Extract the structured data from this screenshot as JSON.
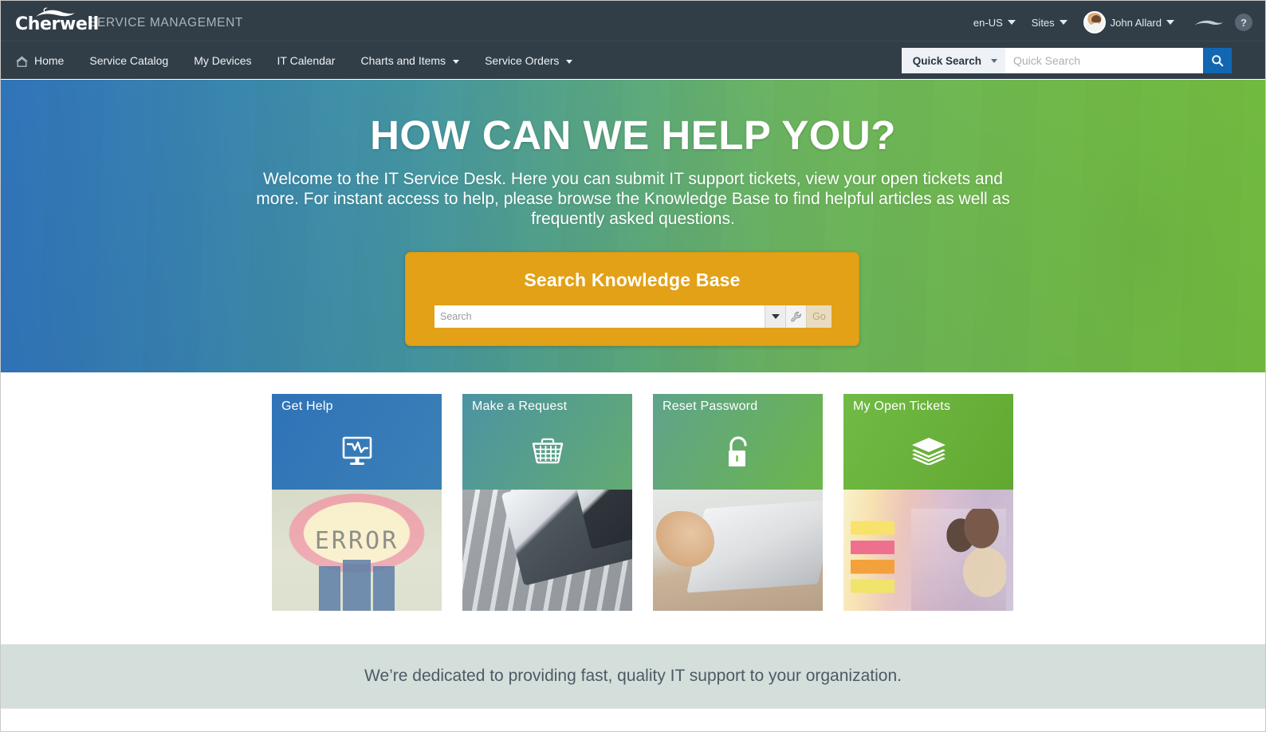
{
  "header": {
    "brand_word": "Cherwell",
    "brand_subtitle": "SERVICE MANAGEMENT",
    "locale": "en-US",
    "sites": "Sites",
    "user_name": "John Allard",
    "help_glyph": "?",
    "icons": {
      "avatar": "avatar",
      "swoosh": "cherwell-swoosh-icon",
      "help": "help-icon"
    }
  },
  "nav": {
    "items": [
      {
        "label": "Home",
        "has_caret": false,
        "icon": "home-icon"
      },
      {
        "label": "Service Catalog",
        "has_caret": false
      },
      {
        "label": "My Devices",
        "has_caret": false
      },
      {
        "label": "IT Calendar",
        "has_caret": false
      },
      {
        "label": "Charts and Items",
        "has_caret": true
      },
      {
        "label": "Service Orders",
        "has_caret": true
      }
    ]
  },
  "quick_search": {
    "scope_label": "Quick Search",
    "placeholder": "Quick Search",
    "value": "",
    "button_icon": "search-icon",
    "button_color": "#1267b3"
  },
  "hero": {
    "title": "HOW CAN WE HELP YOU?",
    "subtitle": "Welcome to the IT Service Desk.  Here you can submit IT support tickets, view your open tickets and more. For instant access to help, please browse the Knowledge Base to find helpful articles as well as frequently asked questions.",
    "gradient_start": "#2d72b8",
    "gradient_end": "#6fb93c"
  },
  "knowledge_base": {
    "title": "Search Knowledge Base",
    "placeholder": "Search",
    "value": "",
    "go_label": "Go",
    "dropdown_icon": "chevron-down-icon",
    "tool_icon": "wrench-icon",
    "panel_color": "#e2a116"
  },
  "tiles": [
    {
      "label": "Get Help",
      "icon": "monitor-error-icon",
      "header_from": "#2f73b8",
      "header_to": "#3f84b4",
      "photo_class": "ph1"
    },
    {
      "label": "Make a Request",
      "icon": "shopping-basket-icon",
      "header_from": "#4c93a3",
      "header_to": "#63ab72",
      "photo_class": "ph2"
    },
    {
      "label": "Reset Password",
      "icon": "padlock-open-icon",
      "header_from": "#5ea38c",
      "header_to": "#6cb64a",
      "photo_class": "ph3"
    },
    {
      "label": "My Open Tickets",
      "icon": "stacked-layers-icon",
      "header_from": "#70bb46",
      "header_to": "#63a931",
      "photo_class": "ph4"
    }
  ],
  "footer": {
    "text": "We’re dedicated to providing fast, quality IT support to your organization.",
    "band_color": "#d4dedb"
  }
}
